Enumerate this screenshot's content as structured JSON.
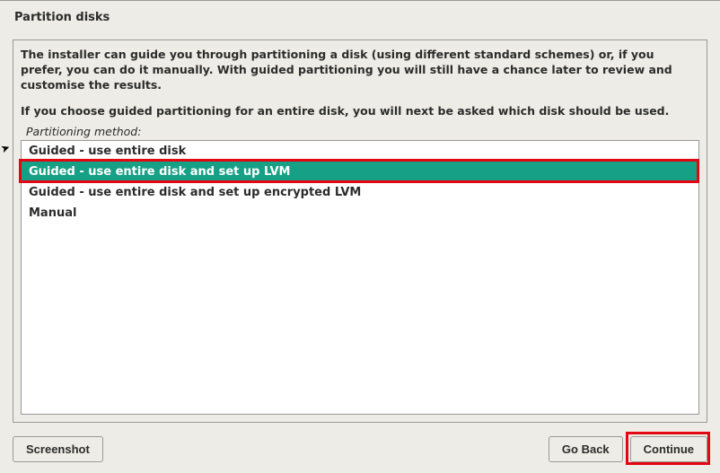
{
  "page": {
    "title": "Partition disks"
  },
  "description": {
    "para1": "The installer can guide you through partitioning a disk (using different standard schemes) or, if you prefer, you can do it manually. With guided partitioning you will still have a chance later to review and customise the results.",
    "para2": "If you choose guided partitioning for an entire disk, you will next be asked which disk should be used."
  },
  "field": {
    "label": "Partitioning method:"
  },
  "options": {
    "items": [
      {
        "label": "Guided - use entire disk",
        "selected": false
      },
      {
        "label": "Guided - use entire disk and set up LVM",
        "selected": true
      },
      {
        "label": "Guided - use entire disk and set up encrypted LVM",
        "selected": false
      },
      {
        "label": "Manual",
        "selected": false
      }
    ]
  },
  "buttons": {
    "screenshot": "Screenshot",
    "goback": "Go Back",
    "continue": "Continue"
  }
}
